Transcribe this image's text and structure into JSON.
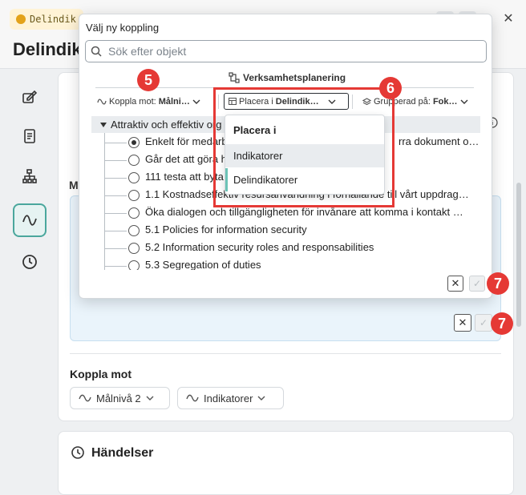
{
  "app": {
    "tab_label": "Delindik",
    "page_title": "Delindik",
    "close_glyph": "✕"
  },
  "sidebar": {
    "items": [
      {
        "icon": "edit-icon"
      },
      {
        "icon": "document-icon"
      },
      {
        "icon": "hierarchy-icon"
      },
      {
        "icon": "wave-icon",
        "active": true
      },
      {
        "icon": "clock-icon"
      }
    ]
  },
  "background": {
    "section_label_partial": "M",
    "koppla_mot_title": "Koppla mot",
    "chips": [
      {
        "label": "Målnivå 2"
      },
      {
        "label": "Indikatorer"
      }
    ],
    "handelser_title": "Händelser"
  },
  "popup": {
    "title": "Välj ny koppling",
    "search_placeholder": "Sök efter objekt",
    "context_label": "Verksamhetsplanering",
    "filters": {
      "koppla_mot_prefix": "Koppla mot:",
      "koppla_mot_value": "Målni…",
      "placera_prefix": "Placera i",
      "placera_value": "Delindik…",
      "grupperad_prefix": "Grupperad på:",
      "grupperad_value": "Fok…"
    },
    "tree": {
      "root_label": "Attraktiv och effektiv org",
      "items": [
        {
          "label": "Enkelt för medarb",
          "label_end": "rra dokument o…",
          "checked": true
        },
        {
          "label": "Går det att göra h",
          "label_end": "",
          "checked": false
        },
        {
          "label": "111 testa att byta",
          "label_end": "",
          "checked": false
        },
        {
          "label": "1.1 Kostnadseffektiv resursanvändning i förhållande till vårt uppdrag…",
          "label_end": "",
          "checked": false
        },
        {
          "label": "Öka dialogen och tillgängligheten för invånare att komma i kontakt …",
          "label_end": "",
          "checked": false
        },
        {
          "label": "5.1 Policies for information security",
          "label_end": "",
          "checked": false
        },
        {
          "label": "5.2 Information security roles and responsabilities",
          "label_end": "",
          "checked": false
        },
        {
          "label": "5.3 Segregation of duties",
          "label_end": "",
          "checked": false
        }
      ]
    },
    "dropdown": {
      "title": "Placera i",
      "options": [
        {
          "label": "Indikatorer",
          "hover": true
        },
        {
          "label": "Delindikatorer",
          "selected": true
        }
      ]
    },
    "cancel_glyph": "✕",
    "confirm_glyph": "✓"
  },
  "annotations": {
    "badge_5": "5",
    "badge_6": "6",
    "badge_7a": "7",
    "badge_7b": "7",
    "color": "#e53935"
  },
  "colors": {
    "accent": "#4aa79d",
    "selected_marker": "#6cc3b6",
    "annotation": "#e53935"
  }
}
